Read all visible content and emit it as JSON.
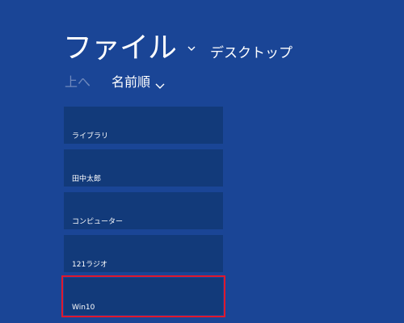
{
  "header": {
    "title": "ファイル",
    "location": "デスクトップ"
  },
  "toolbar": {
    "up_label": "上へ",
    "sort_label": "名前順"
  },
  "tiles": [
    {
      "label": "ライブラリ"
    },
    {
      "label": "田中太郎"
    },
    {
      "label": "コンピューター"
    },
    {
      "label": "121ラジオ"
    },
    {
      "label": "Win10"
    }
  ],
  "colors": {
    "background": "#1a4596",
    "tile": "#123a7a",
    "highlight": "#e0182d"
  }
}
